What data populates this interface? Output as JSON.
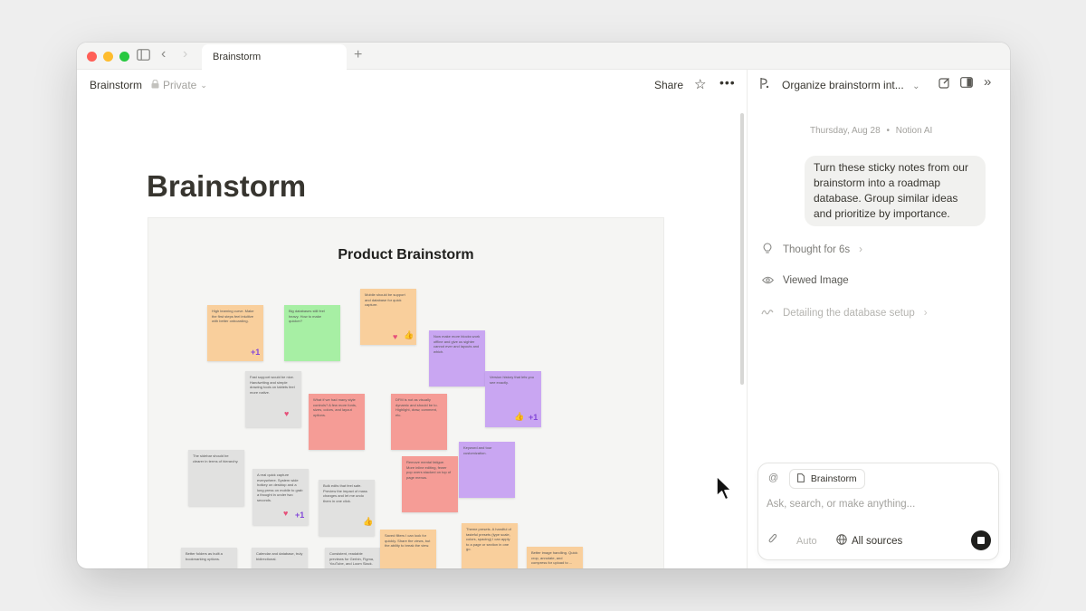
{
  "browser": {
    "tab_title": "Brainstorm",
    "new_tab": "+"
  },
  "header": {
    "breadcrumb": "Brainstorm",
    "privacy": "Private",
    "share_label": "Share"
  },
  "document": {
    "title": "Brainstorm",
    "board_title": "Product Brainstorm",
    "notes": [
      {
        "text": "High learning curve. Make the first steps feel intuitive with better onboarding."
      },
      {
        "text": "Big databases still feel heavy. How to make quicker?"
      },
      {
        "text": "Mobile should be support and database for quick capture."
      },
      {
        "text": "Now make more blocks work offline and give us sighter cannot ever and layouts and which."
      },
      {
        "text": "Fast support would be nice. Handwriting and simple drawing tools on tablets feel more native."
      },
      {
        "text": "What if we had many style controls? A few more fonts, sizes, colors, and layout options."
      },
      {
        "text": "DFM is not as visually dynamic and should be to. Highlight, draw, comment, etc."
      },
      {
        "text": "Version history that lets you see exactly."
      },
      {
        "text": "The sidebar should be clearer in terms of hierarchy."
      },
      {
        "text": "A real quick capture everywhere. System wide hotkey on desktop and a long press on mobile to grab a thought in under two seconds."
      },
      {
        "text": "Bulk edits that feel safe. Preview the impact of mass changes and let me undo them in one click."
      },
      {
        "text": "Remove mental fatigue. More inline editing, fewer pop overs stacked on top of page menus."
      },
      {
        "text": "Keyword and tour customization."
      },
      {
        "text": "Better folders as built a bookmarking options."
      },
      {
        "text": "Calendar and database, truly bidirectional."
      },
      {
        "text": "Consistent, readable previews for Gerbin, Figma, YouTube, and Loom Slack."
      },
      {
        "text": "Saved filters I can look for quickly. Share the views, but the ability to break the view."
      },
      {
        "text": "Theme presets. A handful of tasteful presets (type scale, colors, spacing) I can apply to a page or section in one go."
      },
      {
        "text": "Better image handling. Quick crop, annotate, and compress for upload to ..."
      }
    ]
  },
  "ai_panel": {
    "title": "Organize brainstorm int...",
    "date": "Thursday, Aug 28",
    "separator": "•",
    "author": "Notion AI",
    "user_message": "Turn these sticky notes from our brainstorm into a roadmap database. Group similar ideas and prioritize by importance.",
    "steps": [
      {
        "label": "Thought for 6s",
        "icon": "lightbulb-icon"
      },
      {
        "label": "Viewed Image",
        "icon": "eye-icon"
      },
      {
        "label": "Detailing the database setup",
        "icon": "loader-squiggle-icon"
      }
    ],
    "composer": {
      "context_chip": "Brainstorm",
      "placeholder": "Ask, search, or make anything...",
      "mode": "Auto",
      "sources": "All sources"
    }
  },
  "colors": {
    "note_orange": "#f9cf9c",
    "note_green": "#a7efa4",
    "note_gray": "#e1e1e0",
    "note_purple": "#c9a6f2",
    "note_red": "#f59c96",
    "stop_button": "#1f1f1d"
  }
}
